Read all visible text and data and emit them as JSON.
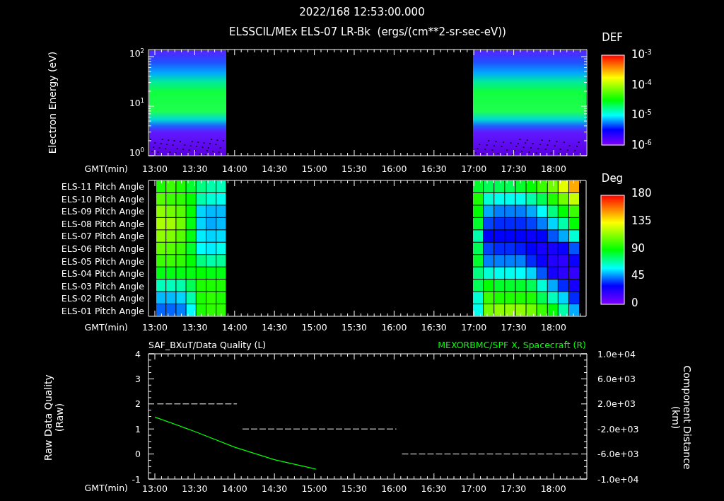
{
  "header": {
    "timestamp": "2022/168 12:53:00.000",
    "title": "ELSSCIL/MEx ELS-07 LR-Bk  (ergs/(cm**2-sr-sec-eV))"
  },
  "energy_panel": {
    "ylabel": "Electron Energy (eV)",
    "yticks": [
      "10$^{2}$",
      "10$^{1}$",
      "10$^{0}$"
    ],
    "xlabel": "GMT(min)",
    "xticks": [
      "13:00",
      "13:30",
      "14:00",
      "14:30",
      "15:00",
      "15:30",
      "16:00",
      "16:30",
      "17:00",
      "17:30",
      "18:00"
    ],
    "colorbar": {
      "title": "DEF",
      "labels": [
        "10$^{-3}$",
        "10$^{-4}$",
        "10$^{-5}$",
        "10$^{-6}$"
      ]
    }
  },
  "pitch_panel": {
    "rows": [
      "ELS-11 Pitch Angle",
      "ELS-10 Pitch Angle",
      "ELS-09 Pitch Angle",
      "ELS-08 Pitch Angle",
      "ELS-07 Pitch Angle",
      "ELS-06 Pitch Angle",
      "ELS-05 Pitch Angle",
      "ELS-04 Pitch Angle",
      "ELS-03 Pitch Angle",
      "ELS-02 Pitch Angle",
      "ELS-01 Pitch Angle"
    ],
    "xlabel": "GMT(min)",
    "xticks": [
      "13:00",
      "13:30",
      "14:00",
      "14:30",
      "15:00",
      "15:30",
      "16:00",
      "16:30",
      "17:00",
      "17:30",
      "18:00"
    ],
    "colorbar": {
      "title": "Deg",
      "labels": [
        "180",
        "135",
        "90",
        "45",
        "0"
      ]
    }
  },
  "quality_panel": {
    "chart_data": {
      "type": "line",
      "title": "SAF_BXuT/Data Quality (L)",
      "xlabel": "GMT(min)",
      "ylabel": "Raw Data Quality (Raw)",
      "xlim": [
        12.92,
        18.42
      ],
      "ylim": [
        -1,
        4
      ],
      "xticks": [
        {
          "value": 13,
          "label": "13:00"
        },
        {
          "value": 13.5,
          "label": "13:30"
        },
        {
          "value": 14,
          "label": "14:00"
        },
        {
          "value": 14.5,
          "label": "14:30"
        },
        {
          "value": 15,
          "label": "15:00"
        },
        {
          "value": 15.5,
          "label": "15:30"
        },
        {
          "value": 16,
          "label": "16:00"
        },
        {
          "value": 16.5,
          "label": "16:30"
        },
        {
          "value": 17,
          "label": "17:00"
        },
        {
          "value": 17.5,
          "label": "17:30"
        },
        {
          "value": 18,
          "label": "18:00"
        }
      ],
      "yticks": [
        {
          "value": 4,
          "label": "4"
        },
        {
          "value": 3,
          "label": "3"
        },
        {
          "value": 2,
          "label": "2"
        },
        {
          "value": 1,
          "label": "1"
        },
        {
          "value": 0,
          "label": "0"
        },
        {
          "value": -1,
          "label": "-1"
        }
      ],
      "x": [
        13.03,
        14.03,
        14.1,
        16.03,
        16.1,
        18.33
      ],
      "series": [
        {
          "color": "#ffffff",
          "line_style": "dashed",
          "values": [
            2,
            2,
            1,
            1,
            0,
            0
          ]
        }
      ]
    },
    "right_chart": {
      "chart_data": {
        "type": "line",
        "title": "MEXORBMC/SPF X, Spacecraft (R)",
        "ylabel": "Component Distance (km)",
        "xlim": [
          12.92,
          18.42
        ],
        "ylim": [
          -10000,
          10000
        ],
        "yticks": [
          {
            "value": 10000,
            "label": "1.0e+04"
          },
          {
            "value": 6000,
            "label": "6.0e+03"
          },
          {
            "value": 2000,
            "label": "2.0e+03"
          },
          {
            "value": -2000,
            "label": "-2.0e+03"
          },
          {
            "value": -6000,
            "label": "-6.0e+03"
          },
          {
            "value": -10000,
            "label": "-1.0e+04"
          }
        ],
        "x": [
          13,
          13.5,
          14,
          14.5,
          15.02
        ],
        "series": [
          {
            "color": "#00ff00",
            "values": [
              -100,
              -2400,
              -4900,
              -6900,
              -8400
            ]
          }
        ]
      }
    }
  }
}
